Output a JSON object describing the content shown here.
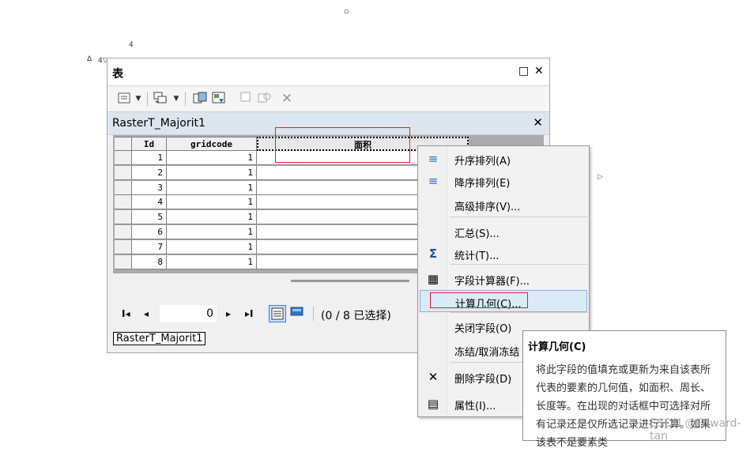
{
  "stray_marks": [
    "▫",
    "4",
    "Δ",
    "4▽",
    "▷"
  ],
  "window": {
    "title": "表",
    "restore_glyph": "□",
    "close_glyph": "✕"
  },
  "toolbar": {
    "icons": [
      "table-options-icon",
      "dropdown-arrow-icon",
      "related-tables-icon",
      "dropdown-arrow-icon",
      "select-by-attributes-icon",
      "switch-selection-icon",
      "clear-selection-icon",
      "zoom-to-selected-icon",
      "delete-selected-icon"
    ]
  },
  "table_tab": {
    "name": "RasterT_Majorit1",
    "close_glyph": "✕"
  },
  "grid": {
    "columns": [
      "Id",
      "gridcode",
      "面积"
    ],
    "rows": [
      {
        "id": "1",
        "gridcode": "1",
        "area": ""
      },
      {
        "id": "2",
        "gridcode": "1",
        "area": ""
      },
      {
        "id": "3",
        "gridcode": "1",
        "area": ""
      },
      {
        "id": "4",
        "gridcode": "1",
        "area": ""
      },
      {
        "id": "5",
        "gridcode": "1",
        "area": ""
      },
      {
        "id": "6",
        "gridcode": "1",
        "area": ""
      },
      {
        "id": "7",
        "gridcode": "1",
        "area": ""
      },
      {
        "id": "8",
        "gridcode": "1",
        "area": ""
      }
    ]
  },
  "nav": {
    "first": "I◂",
    "prev": "◂",
    "position": "0",
    "next": "▸",
    "last": "▸I",
    "status": "(0 / 8 已选择)"
  },
  "bottom_tab": "RasterT_Majorit1",
  "context_menu": {
    "items": [
      {
        "label": "升序排列(A)",
        "icon": "sort-ascending-icon",
        "glyph": "≡"
      },
      {
        "label": "降序排列(E)",
        "icon": "sort-descending-icon",
        "glyph": "≡"
      },
      {
        "label": "高级排序(V)...",
        "icon": "",
        "glyph": ""
      },
      {
        "label": "汇总(S)...",
        "icon": "",
        "glyph": ""
      },
      {
        "label": "统计(T)...",
        "icon": "sigma-icon",
        "glyph": "Σ"
      },
      {
        "label": "字段计算器(F)...",
        "icon": "calculator-icon",
        "glyph": "▦"
      },
      {
        "label": "计算几何(C)...",
        "icon": "",
        "glyph": ""
      },
      {
        "label": "关闭字段(O)",
        "icon": "",
        "glyph": ""
      },
      {
        "label": "冻结/取消冻结",
        "icon": "",
        "glyph": ""
      },
      {
        "label": "删除字段(D)",
        "icon": "delete-icon",
        "glyph": "✕"
      },
      {
        "label": "属性(I)...",
        "icon": "properties-icon",
        "glyph": "▤"
      }
    ]
  },
  "tooltip": {
    "title": "计算几何(C)",
    "body": "将此字段的值填充或更新为来自该表所代表的要素的几何值，如面积、周长、长度等。在出现的对话框中可选择对所有记录还是仅所选记录进行计算。如果该表不是要素类"
  },
  "watermark": "CSDN @Edward-tan",
  "colors": {
    "highlight_red": "#e0202c",
    "menu_hover": "#dbeaf7"
  }
}
